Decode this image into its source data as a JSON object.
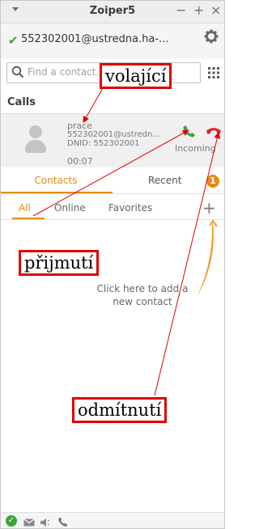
{
  "window": {
    "title": "Zoiper5",
    "minimize_label": "−",
    "maximize_label": "+",
    "close_label": "×"
  },
  "account": {
    "address": "552302001@ustredna.ha-...",
    "status_color": "#3aa63a"
  },
  "search": {
    "placeholder": "Find a contact..."
  },
  "calls": {
    "title": "Calls",
    "entry": {
      "name": "prace",
      "uri": "552302001@ustredn...",
      "dnid": "DNID: 552302001",
      "duration": "00:07",
      "status": "Incoming"
    }
  },
  "tabs": {
    "contacts": "Contacts",
    "recent": "Recent",
    "recent_badge": "1"
  },
  "filters": {
    "all": "All",
    "online": "Online",
    "favorites": "Favorites",
    "add_label": "+"
  },
  "contacts": {
    "empty_hint": "Click here to add a new contact"
  },
  "annotations": {
    "caller": "volající",
    "accept": "přijmutí",
    "reject": "odmítnutí"
  },
  "colors": {
    "accent": "#e58a17",
    "accept": "#3aa63a",
    "reject": "#d6242a",
    "annotation": "#e00000"
  },
  "icons": {
    "menu": "chevron-down-icon",
    "settings": "gear-icon",
    "search": "search-icon",
    "dialpad": "dialpad-icon",
    "accept": "phone-accept-icon",
    "reject": "phone-hangup-icon"
  }
}
